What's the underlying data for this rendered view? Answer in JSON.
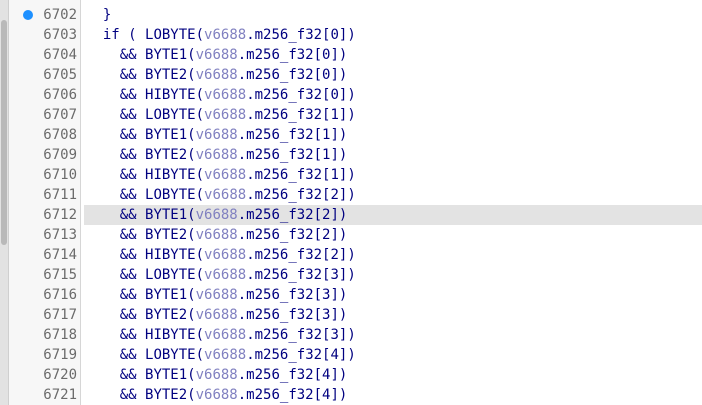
{
  "top_partial_text": "                                                                ",
  "lines": [
    {
      "num": "6702",
      "ops": "  ",
      "func": "}",
      "arg": "",
      "sub": "",
      "tail": "",
      "breakpoint": true
    },
    {
      "num": "6703",
      "ops": "  if ( ",
      "func": "LOBYTE(",
      "arg": "v6688",
      "sub": ".m256_f32[0])",
      "tail": ""
    },
    {
      "num": "6704",
      "ops": "    && ",
      "func": "BYTE1(",
      "arg": "v6688",
      "sub": ".m256_f32[0])",
      "tail": ""
    },
    {
      "num": "6705",
      "ops": "    && ",
      "func": "BYTE2(",
      "arg": "v6688",
      "sub": ".m256_f32[0])",
      "tail": ""
    },
    {
      "num": "6706",
      "ops": "    && ",
      "func": "HIBYTE(",
      "arg": "v6688",
      "sub": ".m256_f32[0])",
      "tail": ""
    },
    {
      "num": "6707",
      "ops": "    && ",
      "func": "LOBYTE(",
      "arg": "v6688",
      "sub": ".m256_f32[1])",
      "tail": ""
    },
    {
      "num": "6708",
      "ops": "    && ",
      "func": "BYTE1(",
      "arg": "v6688",
      "sub": ".m256_f32[1])",
      "tail": ""
    },
    {
      "num": "6709",
      "ops": "    && ",
      "func": "BYTE2(",
      "arg": "v6688",
      "sub": ".m256_f32[1])",
      "tail": ""
    },
    {
      "num": "6710",
      "ops": "    && ",
      "func": "HIBYTE(",
      "arg": "v6688",
      "sub": ".m256_f32[1])",
      "tail": ""
    },
    {
      "num": "6711",
      "ops": "    && ",
      "func": "LOBYTE(",
      "arg": "v6688",
      "sub": ".m256_f32[2])",
      "tail": ""
    },
    {
      "num": "6712",
      "ops": "    && ",
      "func": "BYTE1(",
      "arg": "v6688",
      "sub": ".m256_f32[2])",
      "tail": "",
      "highlight": true
    },
    {
      "num": "6713",
      "ops": "    && ",
      "func": "BYTE2(",
      "arg": "v6688",
      "sub": ".m256_f32[2])",
      "tail": ""
    },
    {
      "num": "6714",
      "ops": "    && ",
      "func": "HIBYTE(",
      "arg": "v6688",
      "sub": ".m256_f32[2])",
      "tail": ""
    },
    {
      "num": "6715",
      "ops": "    && ",
      "func": "LOBYTE(",
      "arg": "v6688",
      "sub": ".m256_f32[3])",
      "tail": ""
    },
    {
      "num": "6716",
      "ops": "    && ",
      "func": "BYTE1(",
      "arg": "v6688",
      "sub": ".m256_f32[3])",
      "tail": ""
    },
    {
      "num": "6717",
      "ops": "    && ",
      "func": "BYTE2(",
      "arg": "v6688",
      "sub": ".m256_f32[3])",
      "tail": ""
    },
    {
      "num": "6718",
      "ops": "    && ",
      "func": "HIBYTE(",
      "arg": "v6688",
      "sub": ".m256_f32[3])",
      "tail": ""
    },
    {
      "num": "6719",
      "ops": "    && ",
      "func": "LOBYTE(",
      "arg": "v6688",
      "sub": ".m256_f32[4])",
      "tail": ""
    },
    {
      "num": "6720",
      "ops": "    && ",
      "func": "BYTE1(",
      "arg": "v6688",
      "sub": ".m256_f32[4])",
      "tail": ""
    },
    {
      "num": "6721",
      "ops": "    && ",
      "func": "BYTE2(",
      "arg": "v6688",
      "sub": ".m256_f32[4])",
      "tail": ""
    }
  ],
  "colors": {
    "keyword": "#000080",
    "variable": "#8080c0",
    "line_number": "#6b6b6b",
    "highlight": "#e3e3e3",
    "breakpoint": "#1e90ff"
  },
  "icons": {
    "breakpoint": "breakpoint-dot-icon"
  }
}
